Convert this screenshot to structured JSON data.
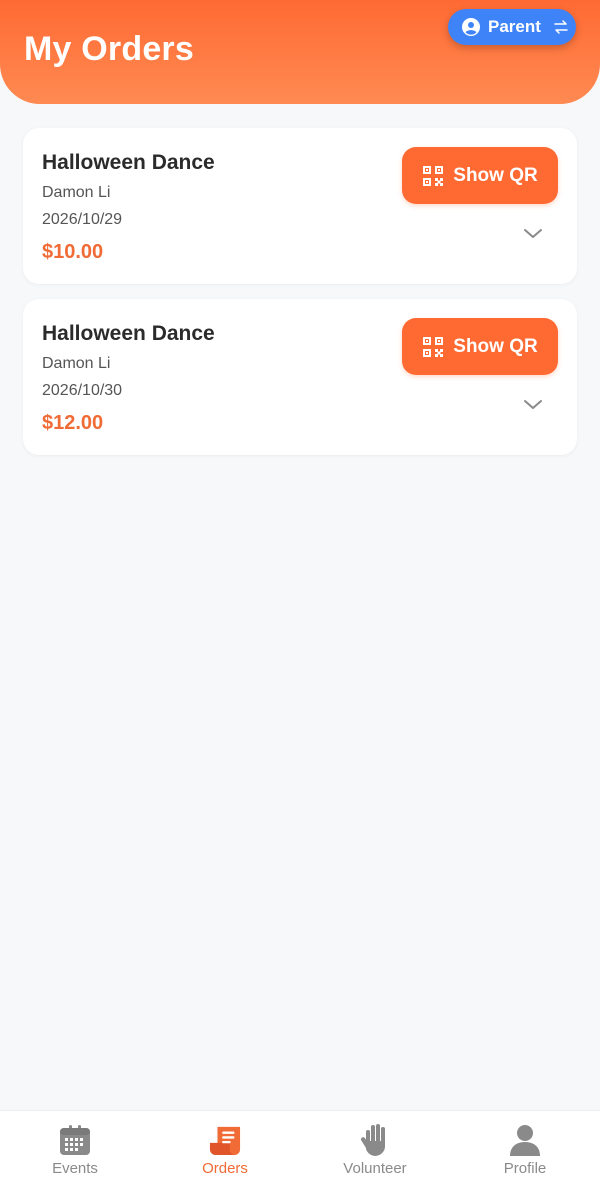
{
  "header": {
    "title": "My Orders",
    "role_switch": {
      "label": "Parent",
      "icon": "user-circle-icon",
      "swap_icon": "swap-arrows-icon"
    }
  },
  "orders": [
    {
      "title": "Halloween Dance",
      "name": "Damon Li",
      "date": "2026/10/29",
      "price": "$10.00",
      "qr_label": "Show QR"
    },
    {
      "title": "Halloween Dance",
      "name": "Damon Li",
      "date": "2026/10/30",
      "price": "$12.00",
      "qr_label": "Show QR"
    }
  ],
  "tabbar": {
    "active": "Orders",
    "items": [
      {
        "label": "Events",
        "icon": "calendar-icon"
      },
      {
        "label": "Orders",
        "icon": "receipt-icon"
      },
      {
        "label": "Volunteer",
        "icon": "hand-icon"
      },
      {
        "label": "Profile",
        "icon": "person-icon"
      }
    ]
  },
  "colors": {
    "accent": "#ff6a33",
    "price": "#f06b35",
    "role_button": "#3f83f8",
    "tab_inactive": "#8a8a8a"
  }
}
